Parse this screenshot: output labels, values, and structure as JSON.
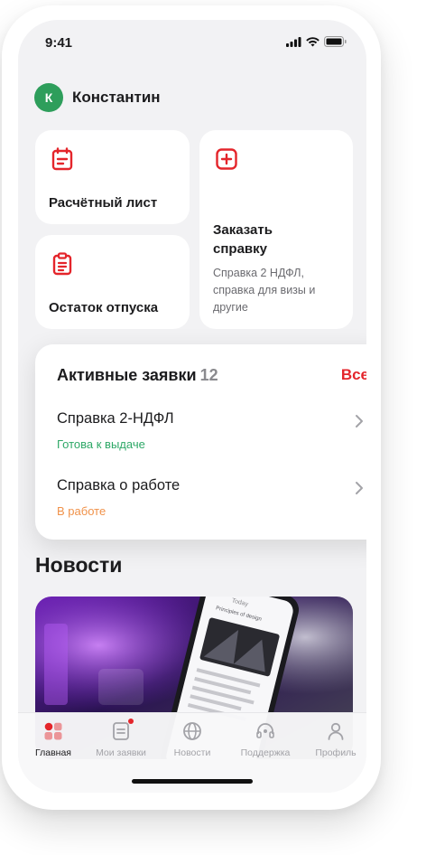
{
  "status_bar": {
    "time": "9:41"
  },
  "user": {
    "initial": "К",
    "name": "Константин"
  },
  "quick_actions": {
    "payslip": {
      "label": "Расчётный лист",
      "icon": "payslip-icon"
    },
    "order_certificate": {
      "label_line1": "Заказать",
      "label_line2": "справку",
      "desc_line1": "Справка 2 НДФЛ,",
      "desc_line2": "справка для визы и",
      "desc_line3": "другие",
      "icon": "plus-square-icon"
    },
    "vacation": {
      "label": "Остаток отпуска",
      "icon": "clipboard-icon"
    }
  },
  "active_requests": {
    "title": "Активные заявки",
    "count": "12",
    "all_label": "Все",
    "items": [
      {
        "name": "Справка 2-НДФЛ",
        "status": "Готова к выдаче",
        "status_color": "#2ea867"
      },
      {
        "name": "Справка о работе",
        "status": "В работе",
        "status_color": "#f0924a"
      }
    ]
  },
  "news": {
    "title": "Новости",
    "image_caption": "Principles of design",
    "image_header": "Today"
  },
  "tab_bar": {
    "tabs": [
      {
        "label": "Главная",
        "icon": "home-grid-icon",
        "active": true
      },
      {
        "label": "Мои заявки",
        "icon": "requests-icon",
        "badge": true
      },
      {
        "label": "Новости",
        "icon": "globe-icon"
      },
      {
        "label": "Поддержка",
        "icon": "headset-icon"
      },
      {
        "label": "Профиль",
        "icon": "person-icon"
      }
    ]
  },
  "colors": {
    "accent": "#e4252b",
    "avatar": "#2e9e5b",
    "ready": "#2ea867",
    "in_progress": "#f0924a"
  }
}
